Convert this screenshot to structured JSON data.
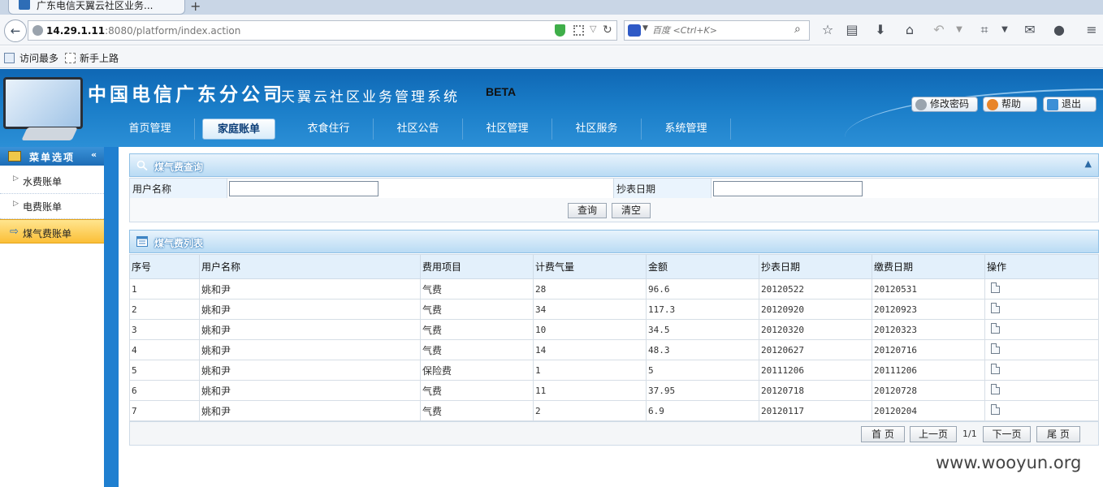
{
  "browser": {
    "tab_title": "广东电信天翼云社区业务...",
    "new_tab": "+",
    "url_host": "14.29.1.11",
    "url_rest": ":8080/platform/index.action",
    "search_placeholder": "百度 <Ctrl+K>",
    "bookmarks": [
      "访问最多",
      "新手上路"
    ]
  },
  "header": {
    "brand": "中国电信广东分公司",
    "system": "天翼云社区业务管理系统",
    "beta": "BETA",
    "buttons": [
      "修改密码",
      "帮助",
      "退出"
    ]
  },
  "nav": {
    "items": [
      "首页管理",
      "家庭账单",
      "衣食住行",
      "社区公告",
      "社区管理",
      "社区服务",
      "系统管理"
    ],
    "active_index": 1
  },
  "sidebar": {
    "title": "菜单选项",
    "collapse_icon": "«",
    "items": [
      "水费账单",
      "电费账单",
      "煤气费账单"
    ],
    "active_index": 2
  },
  "query": {
    "title": "煤气费查询",
    "collapse_icon": "▲",
    "user_label": "用户名称",
    "date_label": "抄表日期",
    "user_value": "",
    "date_value": "",
    "query_btn": "查询",
    "clear_btn": "清空"
  },
  "list": {
    "title": "煤气费列表",
    "headers": [
      "序号",
      "用户名称",
      "费用项目",
      "计费气量",
      "金额",
      "抄表日期",
      "缴费日期",
      "操作"
    ],
    "rows": [
      [
        "1",
        "姚和尹",
        "气费",
        "28",
        "96.6",
        "20120522",
        "20120531"
      ],
      [
        "2",
        "姚和尹",
        "气费",
        "34",
        "117.3",
        "20120920",
        "20120923"
      ],
      [
        "3",
        "姚和尹",
        "气费",
        "10",
        "34.5",
        "20120320",
        "20120323"
      ],
      [
        "4",
        "姚和尹",
        "气费",
        "14",
        "48.3",
        "20120627",
        "20120716"
      ],
      [
        "5",
        "姚和尹",
        "保险费",
        "1",
        "5",
        "20111206",
        "20111206"
      ],
      [
        "6",
        "姚和尹",
        "气费",
        "11",
        "37.95",
        "20120718",
        "20120728"
      ],
      [
        "7",
        "姚和尹",
        "气费",
        "2",
        "6.9",
        "20120117",
        "20120204"
      ]
    ]
  },
  "pager": {
    "first": "首 页",
    "prev": "上一页",
    "info": "1/1",
    "next": "下一页",
    "last": "尾 页"
  },
  "watermark": "www.wooyun.org",
  "colors": {
    "header_blue": "#1a7dc8",
    "active_menu": "#fbbf37",
    "table_header": "#e3f0fb"
  }
}
